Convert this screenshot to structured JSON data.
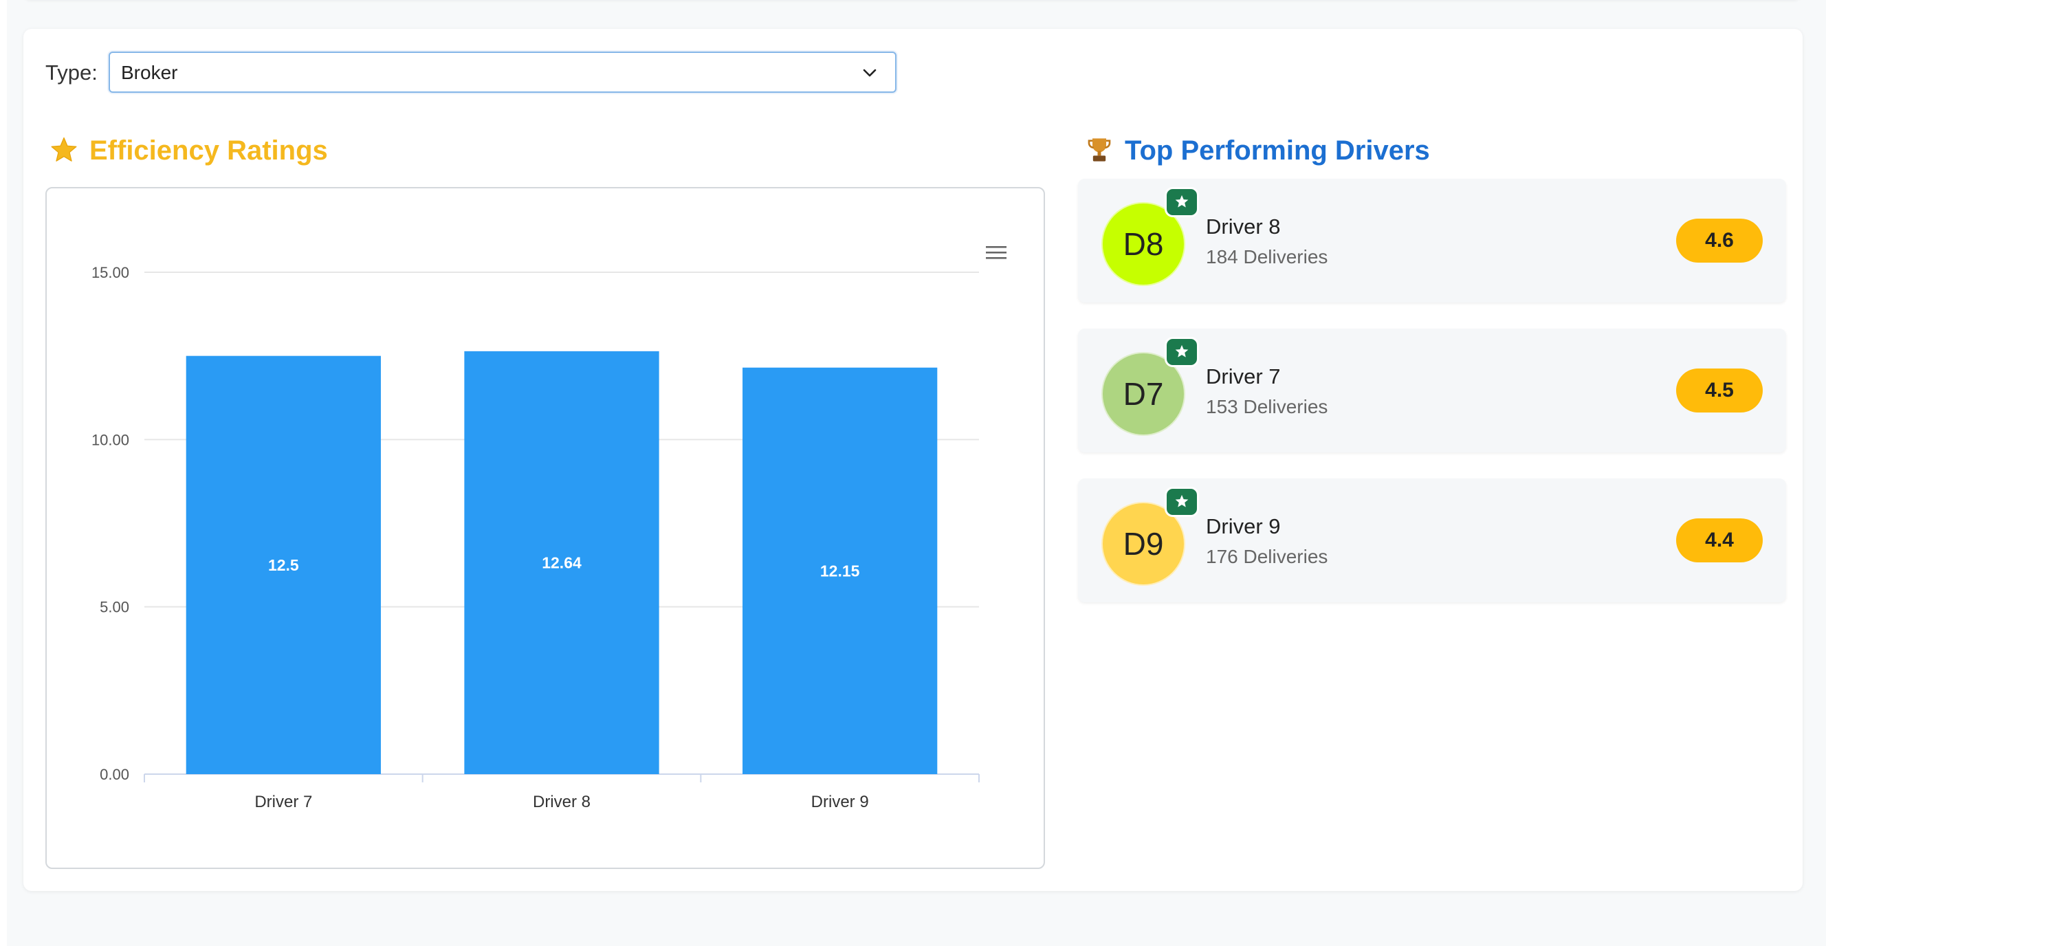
{
  "filter": {
    "label": "Type:",
    "value": "Broker"
  },
  "efficiency": {
    "title": "Efficiency Ratings",
    "icon": "star-icon"
  },
  "top": {
    "title": "Top Performing Drivers",
    "icon": "trophy-icon"
  },
  "drivers": [
    {
      "initials": "D8",
      "name": "Driver 8",
      "deliveries": "184 Deliveries",
      "rating": "4.6",
      "avatar_color": "#c6ff00"
    },
    {
      "initials": "D7",
      "name": "Driver 7",
      "deliveries": "153 Deliveries",
      "rating": "4.5",
      "avatar_color": "#aed581"
    },
    {
      "initials": "D9",
      "name": "Driver 9",
      "deliveries": "176 Deliveries",
      "rating": "4.4",
      "avatar_color": "#ffd54f"
    }
  ],
  "colors": {
    "bar": "#2a9bf4",
    "accent_title": "#f5b81e",
    "top_title": "#1c6fd1",
    "rating": "#ffbb0a",
    "badge": "#1b7a4d"
  },
  "chart_data": {
    "type": "bar",
    "categories": [
      "Driver 7",
      "Driver 8",
      "Driver 9"
    ],
    "values": [
      12.5,
      12.64,
      12.15
    ],
    "value_labels": [
      "12.5",
      "12.64",
      "12.15"
    ],
    "yticks": [
      "0.00",
      "5.00",
      "10.00",
      "15.00"
    ],
    "ylim": [
      0,
      15
    ],
    "grid": true,
    "data_labels": true
  }
}
